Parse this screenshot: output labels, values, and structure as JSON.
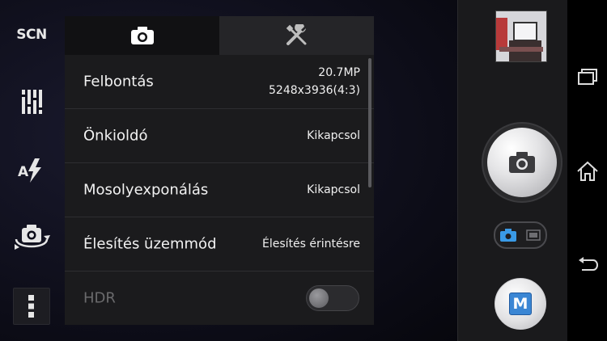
{
  "left_toolbar": {
    "scene_label": "SCN",
    "items": [
      {
        "icon": "scene-icon"
      },
      {
        "icon": "sliders-icon"
      },
      {
        "icon": "auto-flash-icon"
      },
      {
        "icon": "switch-camera-icon"
      },
      {
        "icon": "more-icon"
      }
    ]
  },
  "settings_panel": {
    "tabs": [
      {
        "icon": "camera-icon",
        "active": true
      },
      {
        "icon": "tools-icon",
        "active": false
      }
    ],
    "rows": [
      {
        "label": "Felbontás",
        "value_line1": "20.7MP",
        "value_line2": "5248x3936(4:3)"
      },
      {
        "label": "Önkioldó",
        "value": "Kikapcsol"
      },
      {
        "label": "Mosolyexponálás",
        "value": "Kikapcsol"
      },
      {
        "label": "Élesítés üzemmód",
        "value": "Élesítés érintésre"
      },
      {
        "label": "HDR",
        "toggle": "off",
        "disabled": true
      }
    ]
  },
  "camera_controls": {
    "thumbnail": "last-photo-thumbnail",
    "shutter": "camera-shutter-icon",
    "mode_switch": [
      "camera-mode-icon",
      "video-mode-icon"
    ],
    "capture_mode": "M"
  },
  "nav_bar": [
    "recent-apps-icon",
    "home-icon",
    "back-icon"
  ],
  "colors": {
    "panel_bg": "#1b1b1d",
    "active_tab": "#111113",
    "accent_blue": "#3a86d4"
  }
}
